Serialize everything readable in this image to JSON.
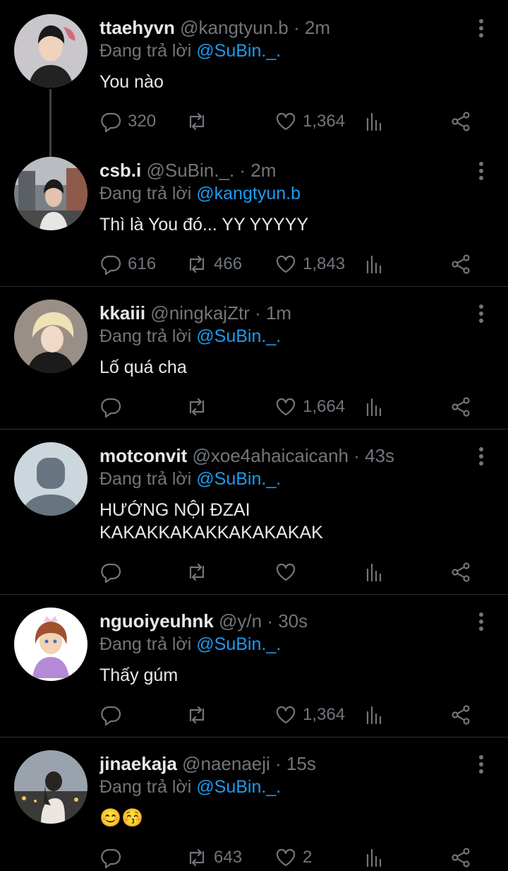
{
  "tweets": [
    {
      "name": "ttaehyvn",
      "handle": "@kangtyun.b",
      "time": "· 2m",
      "reply_prefix": "Đang trả lời ",
      "reply_to": "@SuBin._.",
      "text": "You nào",
      "replies": "320",
      "retweets": "",
      "likes": "1,364"
    },
    {
      "name": "csb.i",
      "handle": "@SuBin._.",
      "time": "· 2m",
      "reply_prefix": "Đang trả lời ",
      "reply_to": "@kangtyun.b",
      "text": "Thì là You đó... YY YYYYY",
      "replies": "616",
      "retweets": "466",
      "likes": "1,843"
    },
    {
      "name": "kkaiii",
      "handle": "@ningkajZtr",
      "time": "· 1m",
      "reply_prefix": "Đang trả lời ",
      "reply_to": "@SuBin._.",
      "text": "Lố quá cha",
      "replies": "",
      "retweets": "",
      "likes": "1,664"
    },
    {
      "name": "motconvit",
      "handle": "@xoe4ahaicaicanh",
      "time": "· 43s",
      "reply_prefix": "Đang trả lời ",
      "reply_to": "@SuBin._.",
      "text_line1": "HƯỚNG NỘI ĐZAI",
      "text_line2": "KAKAKKAKAKKAKAKAKAK",
      "replies": "",
      "retweets": "",
      "likes": ""
    },
    {
      "name": "nguoiyeuhnk",
      "handle": "@y/n",
      "time": "· 30s",
      "reply_prefix": "Đang trả lời ",
      "reply_to": "@SuBin._.",
      "text": "Thấy gúm",
      "replies": "",
      "retweets": "",
      "likes": "1,364"
    },
    {
      "name": "jinaekaja",
      "handle": "@naenaeji",
      "time": "· 15s",
      "reply_prefix": "Đang trả lời ",
      "reply_to": "@SuBin._.",
      "text": "😊😚",
      "replies": "",
      "retweets": "643",
      "likes": "2"
    }
  ],
  "icons": {
    "reply": "speech-bubble-icon",
    "retweet": "retweet-icon",
    "like": "heart-icon",
    "views": "bar-chart-icon",
    "share": "share-icon",
    "more": "vertical-ellipsis-icon"
  },
  "colors": {
    "background": "#000000",
    "text": "#e7e9ea",
    "muted": "#71767b",
    "link": "#1d9bf0",
    "divider": "#2f3336"
  }
}
